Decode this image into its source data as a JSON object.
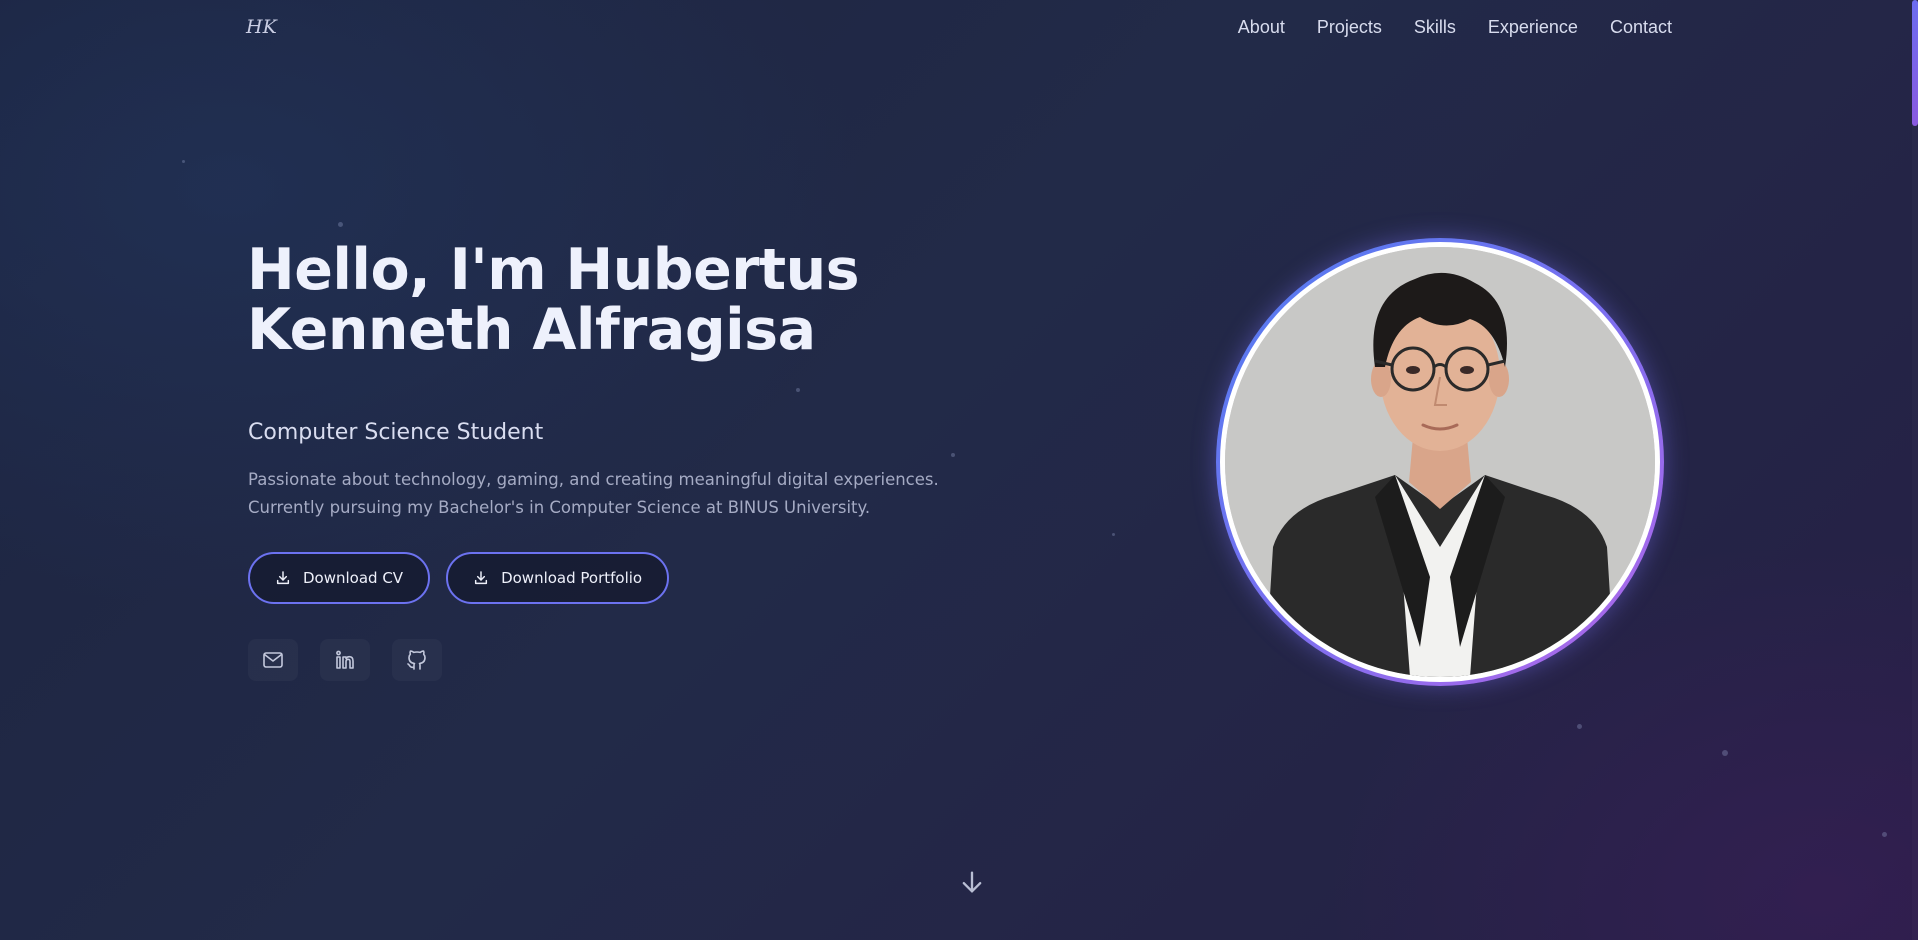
{
  "header": {
    "logo": "HK",
    "nav": [
      "About",
      "Projects",
      "Skills",
      "Experience",
      "Contact"
    ]
  },
  "hero": {
    "title_line1": "Hello, I'm Hubertus",
    "title_line2": "Kenneth Alfragisa",
    "subtitle": "Computer Science Student",
    "description_line1": "Passionate about technology, gaming, and creating meaningful digital experiences.",
    "description_line2": "Currently pursuing my Bachelor's in Computer Science at BINUS University.",
    "buttons": {
      "cv": "Download CV",
      "portfolio": "Download Portfolio"
    },
    "socials": [
      "mail-icon",
      "linkedin-icon",
      "github-icon"
    ]
  },
  "colors": {
    "accent": "#6c72f0",
    "accent_purple": "#b567e8",
    "background": "#222a48",
    "text": "#eef1fc",
    "muted": "#a5abc4"
  }
}
